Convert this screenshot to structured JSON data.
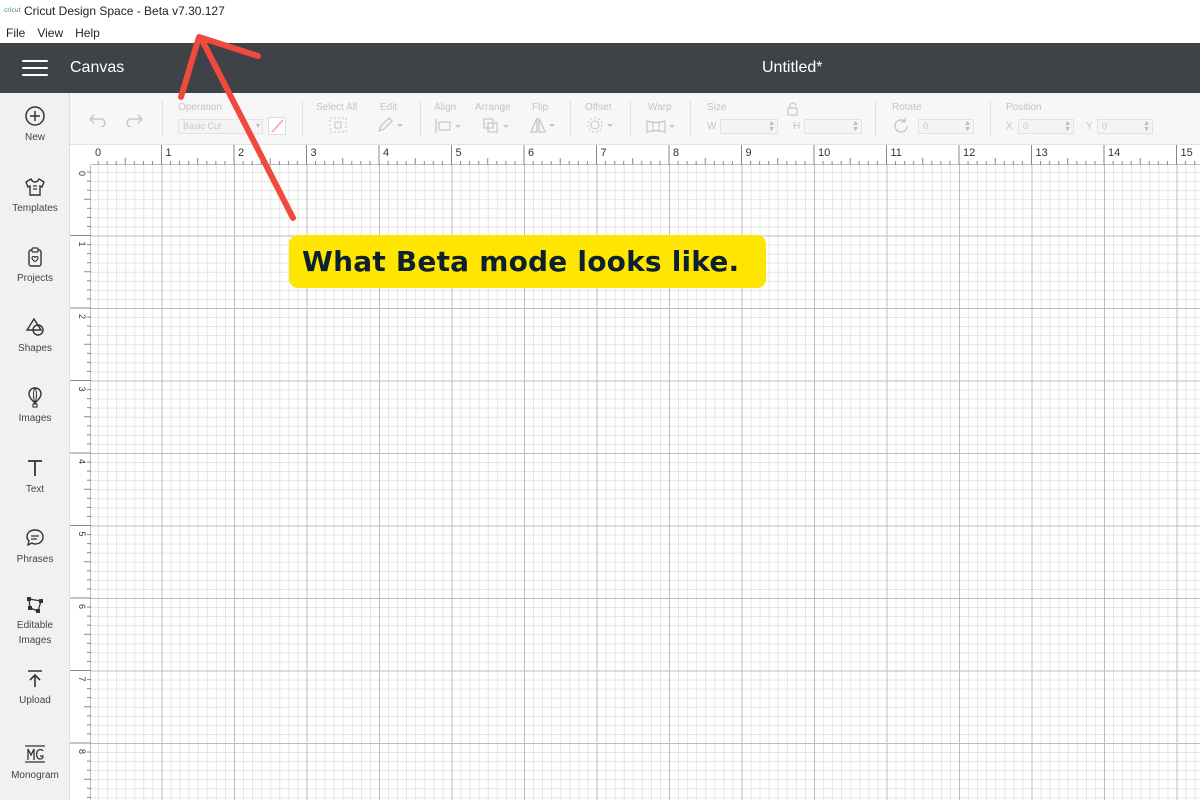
{
  "window": {
    "title": "Cricut Design Space - Beta v7.30.127",
    "logo_text": "cricut"
  },
  "menubar": {
    "items": [
      "File",
      "View",
      "Help"
    ]
  },
  "header": {
    "section": "Canvas",
    "project_title": "Untitled*"
  },
  "sidebar": {
    "items": [
      {
        "label": "New",
        "icon": "plus-circle-icon"
      },
      {
        "label": "Templates",
        "icon": "shirt-icon"
      },
      {
        "label": "Projects",
        "icon": "clipboard-icon"
      },
      {
        "label": "Shapes",
        "icon": "shapes-icon"
      },
      {
        "label": "Images",
        "icon": "balloon-icon"
      },
      {
        "label": "Text",
        "icon": "text-icon"
      },
      {
        "label": "Phrases",
        "icon": "speech-bubble-icon"
      },
      {
        "label": "Editable Images",
        "icon": "editable-images-icon"
      },
      {
        "label": "Upload",
        "icon": "upload-icon"
      },
      {
        "label": "Monogram",
        "icon": "monogram-icon"
      }
    ]
  },
  "toolbar": {
    "operation_label": "Operation",
    "operation_value": "Basic Cut",
    "select_all_label": "Select All",
    "edit_label": "Edit",
    "align_label": "Align",
    "arrange_label": "Arrange",
    "flip_label": "Flip",
    "offset_label": "Offset",
    "warp_label": "Warp",
    "size_label": "Size",
    "size_w_label": "W",
    "size_h_label": "H",
    "rotate_label": "Rotate",
    "rotate_value": "0",
    "position_label": "Position",
    "position_x_label": "X",
    "position_x_value": "0",
    "position_y_label": "Y",
    "position_y_value": "0"
  },
  "rulers": {
    "horizontal": [
      "0",
      "1",
      "2",
      "3",
      "4",
      "5",
      "6",
      "7",
      "8",
      "9",
      "10",
      "11",
      "12",
      "13",
      "14",
      "15"
    ],
    "vertical": [
      "0",
      "1",
      "2",
      "3",
      "4",
      "5",
      "6",
      "7",
      "8"
    ]
  },
  "annotation": {
    "text": "What Beta mode looks like.",
    "arrow_color": "#f04a3e",
    "box_color": "#ffe600"
  }
}
